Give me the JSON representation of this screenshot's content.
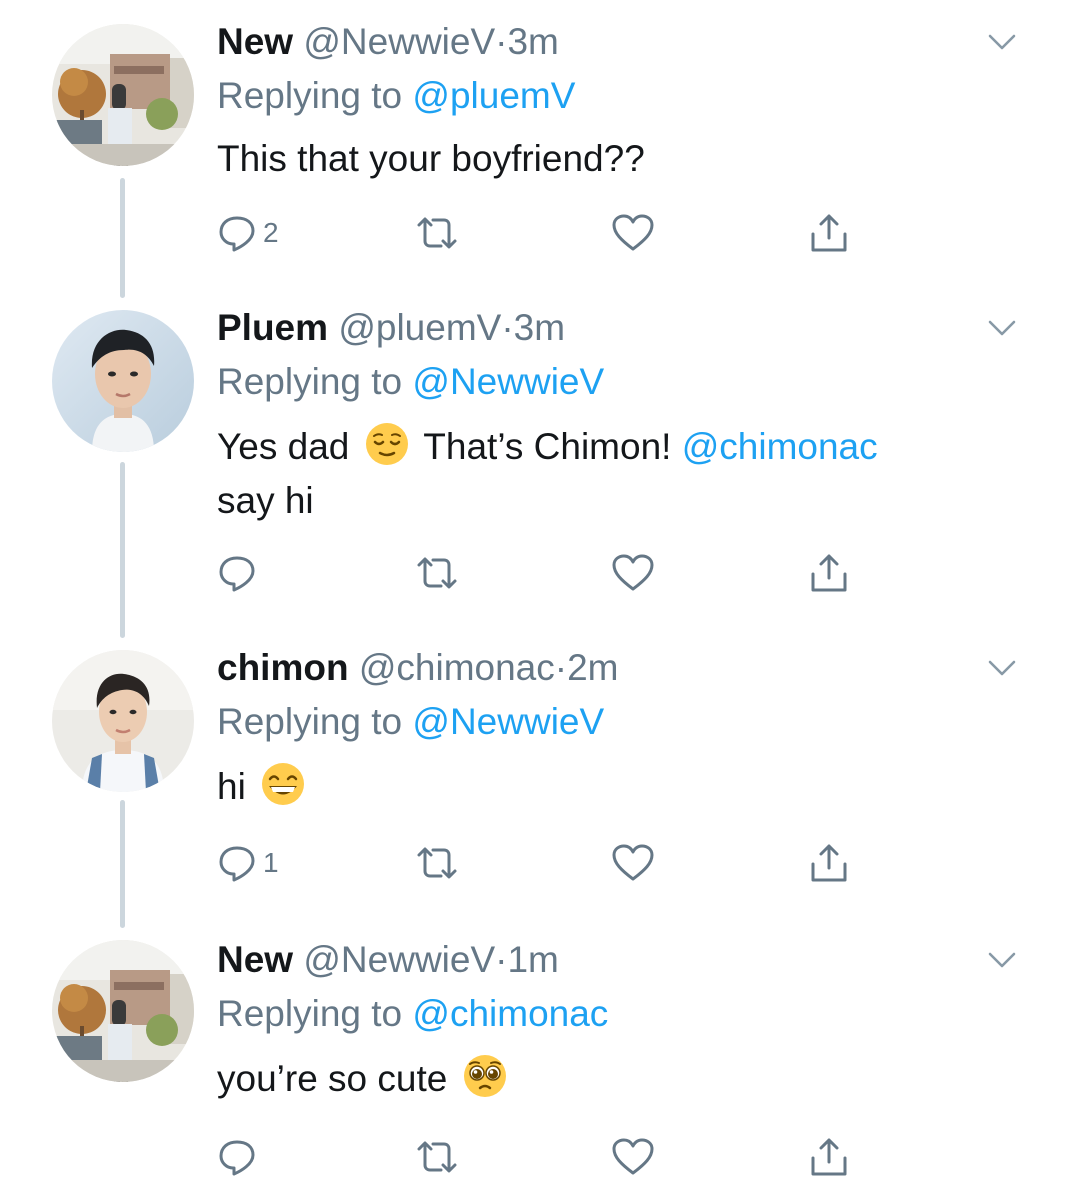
{
  "tweets": [
    {
      "name": "New",
      "handle": "@NewwieV",
      "separator": "·",
      "time": "3m",
      "replying_prefix": "Replying to",
      "replying_to": "@pluemV",
      "text_line1": "This that your boyfriend??",
      "reply_count": "2",
      "avatar_icon": "avatar-street-photo"
    },
    {
      "name": "Pluem",
      "handle": "@pluemV",
      "separator": "·",
      "time": "3m",
      "replying_prefix": "Replying to",
      "replying_to": "@NewwieV",
      "text_a": "Yes dad",
      "emoji1": "relieved-face-emoji",
      "text_b": "That’s Chimon!",
      "mention": "@chimonac",
      "text_line2": "say hi",
      "reply_count": "",
      "avatar_icon": "avatar-portrait"
    },
    {
      "name": "chimon",
      "handle": "@chimonac",
      "separator": "·",
      "time": "2m",
      "replying_prefix": "Replying to",
      "replying_to": "@NewwieV",
      "text_line1": "hi",
      "emoji1": "grinning-face-emoji",
      "reply_count": "1",
      "avatar_icon": "avatar-portrait"
    },
    {
      "name": "New",
      "handle": "@NewwieV",
      "separator": "·",
      "time": "1m",
      "replying_prefix": "Replying to",
      "replying_to": "@chimonac",
      "text_line1": "you’re so cute",
      "emoji1": "pleading-face-emoji",
      "reply_count": "",
      "avatar_icon": "avatar-street-photo"
    }
  ],
  "colors": {
    "text": "#14171a",
    "muted": "#657786",
    "link": "#1da1f2",
    "thread_line": "#ccd6dd"
  },
  "icons": [
    "reply-icon",
    "retweet-icon",
    "like-icon",
    "share-icon",
    "caret-down-icon"
  ]
}
